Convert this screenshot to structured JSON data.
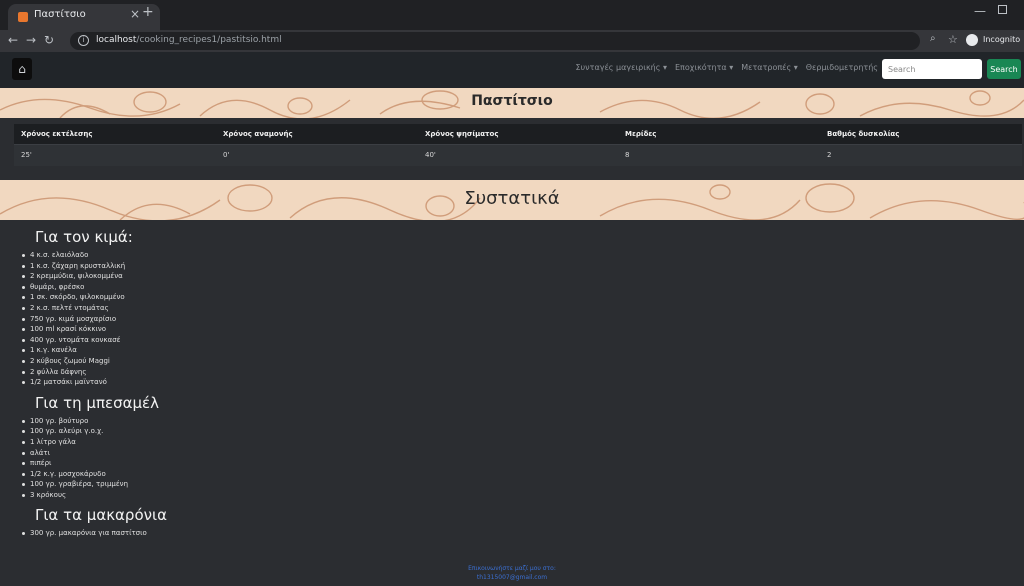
{
  "browser": {
    "tab_title": "Παστίτσιο",
    "tab_close": "×",
    "new_tab": "+",
    "url_host": "localhost",
    "url_path": "/cooking_recipes1/pastitsio.html",
    "profile_label": "Incognito"
  },
  "navbar": {
    "links": [
      {
        "label": "Συνταγές μαγειρικής ▾"
      },
      {
        "label": "Εποχικότητα ▾"
      },
      {
        "label": "Μετατροπές ▾"
      },
      {
        "label": "Θερμιδομετρητής"
      }
    ],
    "search_placeholder": "Search",
    "search_button": "Search"
  },
  "recipe": {
    "title": "Παστίτσιο",
    "info_headers": [
      "Χρόνος εκτέλεσης",
      "Χρόνος αναμονής",
      "Χρόνος ψησίματος",
      "Μερίδες",
      "Βαθμός δυσκολίας"
    ],
    "info_values": [
      "25'",
      "0'",
      "40'",
      "8",
      "2"
    ]
  },
  "ingredients": {
    "heading": "Συστατικά",
    "sections": [
      {
        "title": "Για τον κιμά:",
        "items": [
          "4 κ.σ. ελαιόλαδο",
          "1 κ.σ. ζάχαρη κρυσταλλική",
          "2 κρεμμύδια, ψιλοκομμένα",
          "θυμάρι, φρέσκο",
          "1 σκ. σκόρδο, ψιλοκομμένο",
          "2 κ.σ. πελτέ ντομάτας",
          "750 γρ. κιμά μοσχαρίσιο",
          "100 ml κρασί κόκκινο",
          "400 γρ. ντομάτα κονκασέ",
          "1 κ.γ. κανέλα",
          "2 κύβους ζωμού Maggi",
          "2 φύλλα δάφνης",
          "1/2 ματσάκι μαϊντανό"
        ]
      },
      {
        "title": "Για τη μπεσαμέλ",
        "items": [
          "100 γρ. βούτυρο",
          "100 γρ. αλεύρι γ.ο.χ.",
          "1 λίτρο γάλα",
          "αλάτι",
          "πιπέρι",
          "1/2 κ.γ. μοσχοκάρυδο",
          "100 γρ. γραβιέρα, τριμμένη",
          "3 κρόκους"
        ]
      },
      {
        "title": "Για τα μακαρόνια",
        "items": [
          "300 γρ. μακαρόνια για παστίτσιο"
        ]
      }
    ]
  },
  "footer": {
    "line1": "Επικοινωνήστε μαζί μου στο:",
    "line2": "th1315007@gmail.com"
  }
}
